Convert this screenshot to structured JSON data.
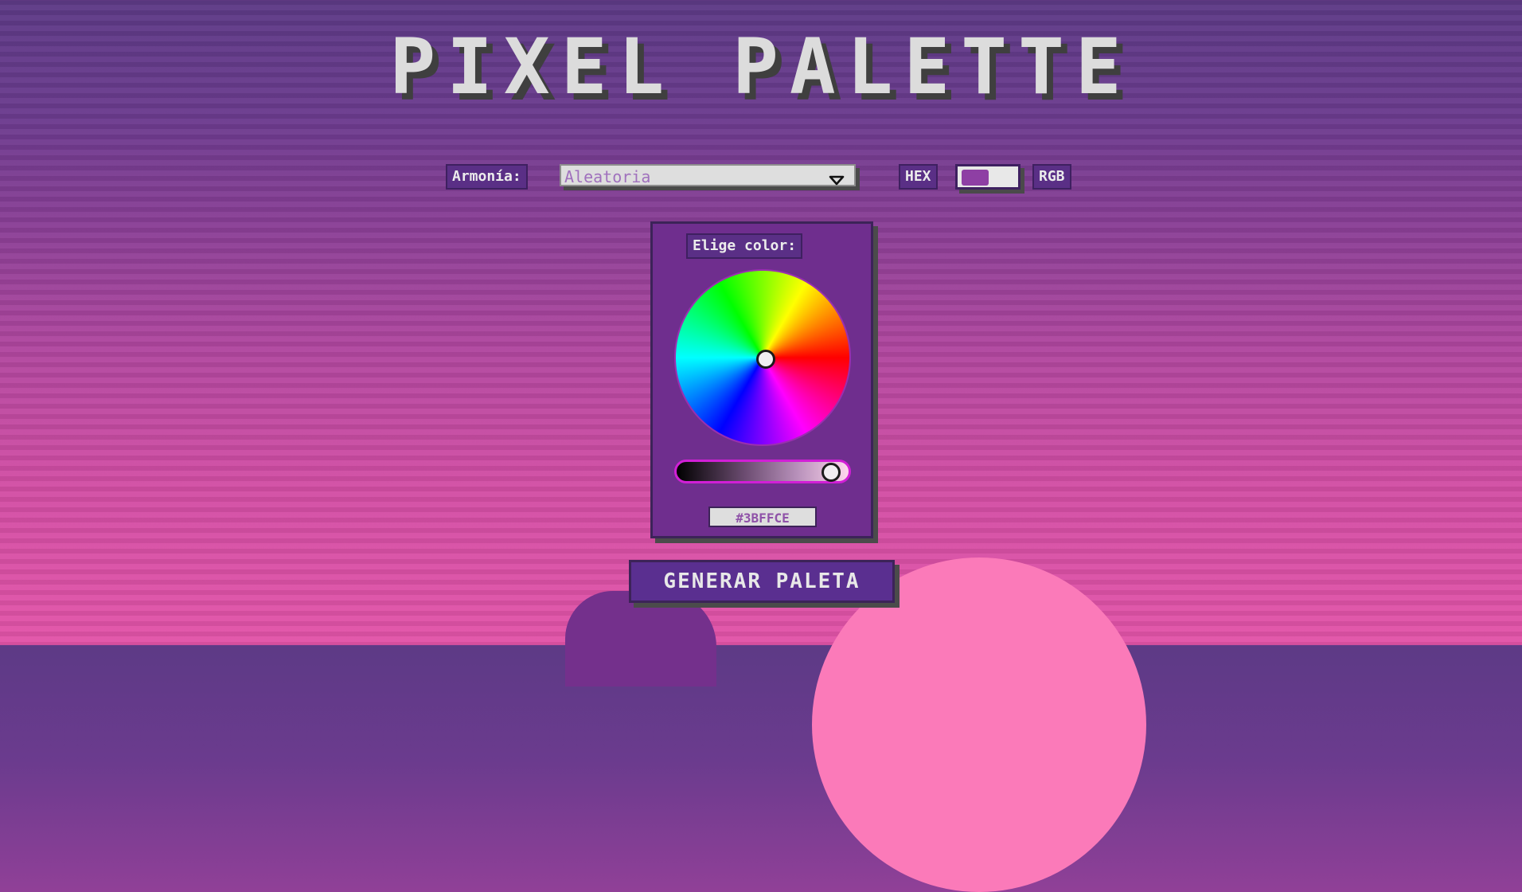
{
  "title": "PIXEL PALETTE",
  "controls": {
    "harmony_label": "Armonía:",
    "harmony_value": "Aleatoria",
    "format_left": "HEX",
    "format_right": "RGB"
  },
  "picker": {
    "label": "Elige color:",
    "hex_value": "#3BFFCE"
  },
  "generate_button": "GENERAR PALETA",
  "colors": {
    "background_top": "#5d3a86",
    "background_bottom": "#e254a8",
    "panel": "#6f2e8e",
    "button": "#5a2f90",
    "title_text": "#dcdcdc"
  },
  "icons": {
    "dropdown": "chevron-down-icon"
  }
}
